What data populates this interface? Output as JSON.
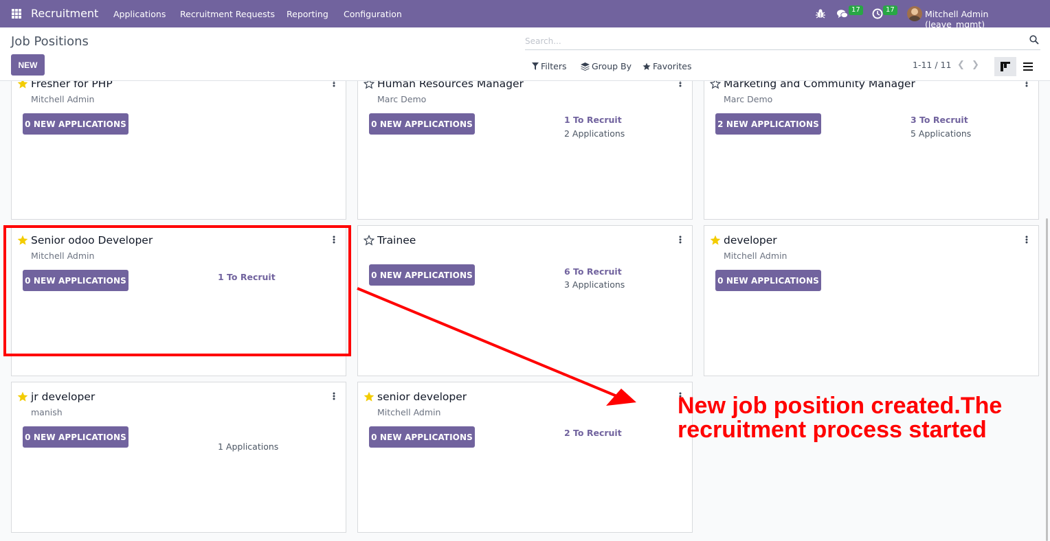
{
  "navbar": {
    "app_name": "Recruitment",
    "menu": [
      "Applications",
      "Recruitment Requests",
      "Reporting",
      "Configuration"
    ],
    "messages_count": "17",
    "activities_count": "17",
    "user": "Mitchell Admin (leave_mgmt)"
  },
  "control_panel": {
    "title": "Job Positions",
    "new_label": "NEW",
    "search_placeholder": "Search...",
    "filters_label": "Filters",
    "group_by_label": "Group By",
    "favorites_label": "Favorites",
    "pager": "1-11 / 11"
  },
  "cards": [
    {
      "title": "Fresher for PHP",
      "subtitle": "Mitchell Admin",
      "starred": true,
      "button": "0 NEW APPLICATIONS",
      "to_recruit": "",
      "applications": ""
    },
    {
      "title": "Human Resources Manager",
      "subtitle": "Marc Demo",
      "starred": false,
      "button": "0 NEW APPLICATIONS",
      "to_recruit": "1 To Recruit",
      "applications": "2 Applications"
    },
    {
      "title": "Marketing and Community Manager",
      "subtitle": "Marc Demo",
      "starred": false,
      "button": "2 NEW APPLICATIONS",
      "to_recruit": "3 To Recruit",
      "applications": "5 Applications"
    },
    {
      "title": "Senior odoo Developer",
      "subtitle": "Mitchell Admin",
      "starred": true,
      "button": "0 NEW APPLICATIONS",
      "to_recruit": "1 To Recruit",
      "applications": ""
    },
    {
      "title": "Trainee",
      "subtitle": "",
      "starred": false,
      "button": "0 NEW APPLICATIONS",
      "to_recruit": "6 To Recruit",
      "applications": "3 Applications"
    },
    {
      "title": "developer",
      "subtitle": "Mitchell Admin",
      "starred": true,
      "button": "0 NEW APPLICATIONS",
      "to_recruit": "",
      "applications": ""
    },
    {
      "title": "jr developer",
      "subtitle": "manish",
      "starred": true,
      "button": "0 NEW APPLICATIONS",
      "to_recruit": "",
      "applications": "1 Applications"
    },
    {
      "title": "senior developer",
      "subtitle": "Mitchell Admin",
      "starred": true,
      "button": "0 NEW APPLICATIONS",
      "to_recruit": "2 To Recruit",
      "applications": ""
    }
  ],
  "annotation": {
    "line1": "New job position created.The",
    "line2": "recruitment process started"
  },
  "colors": {
    "brand": "#71639e",
    "star_filled": "#f3cc00",
    "highlight": "#ff0000"
  }
}
